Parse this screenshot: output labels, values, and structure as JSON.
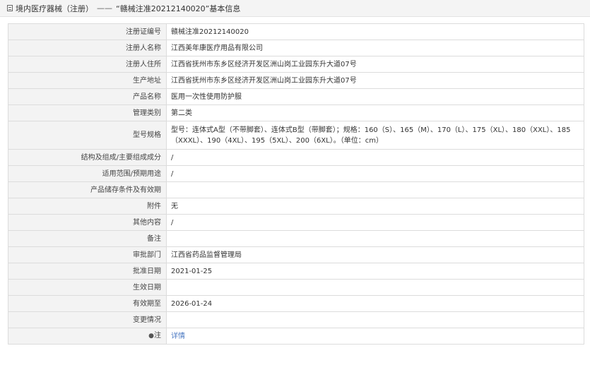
{
  "header": {
    "category": "境内医疗器械（注册）",
    "separator": "——",
    "title": "“赣械注准20212140020”基本信息"
  },
  "rows": [
    {
      "label": "注册证编号",
      "value": "赣械注准20212140020"
    },
    {
      "label": "注册人名称",
      "value": "江西美年康医疗用品有限公司"
    },
    {
      "label": "注册人住所",
      "value": "江西省抚州市东乡区经济开发区洲山岗工业园东升大道07号"
    },
    {
      "label": "生产地址",
      "value": "江西省抚州市东乡区经济开发区洲山岗工业园东升大道07号"
    },
    {
      "label": "产品名称",
      "value": "医用一次性使用防护服"
    },
    {
      "label": "管理类别",
      "value": "第二类"
    },
    {
      "label": "型号规格",
      "value": "型号：连体式A型（不带脚套）、连体式B型（带脚套）；规格：160（S）、165（M）、170（L）、175（XL）、180（XXL）、185（XXXL）、190（4XL）、195（5XL）、200（6XL）。（单位：cm）"
    },
    {
      "label": "结构及组成/主要组成成分",
      "value": "/"
    },
    {
      "label": "适用范围/预期用途",
      "value": "/"
    },
    {
      "label": "产品储存条件及有效期",
      "value": ""
    },
    {
      "label": "附件",
      "value": "无"
    },
    {
      "label": "其他内容",
      "value": "/"
    },
    {
      "label": "备注",
      "value": ""
    },
    {
      "label": "审批部门",
      "value": "江西省药品监督管理局"
    },
    {
      "label": "批准日期",
      "value": "2021-01-25"
    },
    {
      "label": "生效日期",
      "value": ""
    },
    {
      "label": "有效期至",
      "value": "2026-01-24"
    },
    {
      "label": "变更情况",
      "value": ""
    }
  ],
  "note_row": {
    "icon_glyph": "●",
    "label": "注",
    "link_text": "详情"
  }
}
